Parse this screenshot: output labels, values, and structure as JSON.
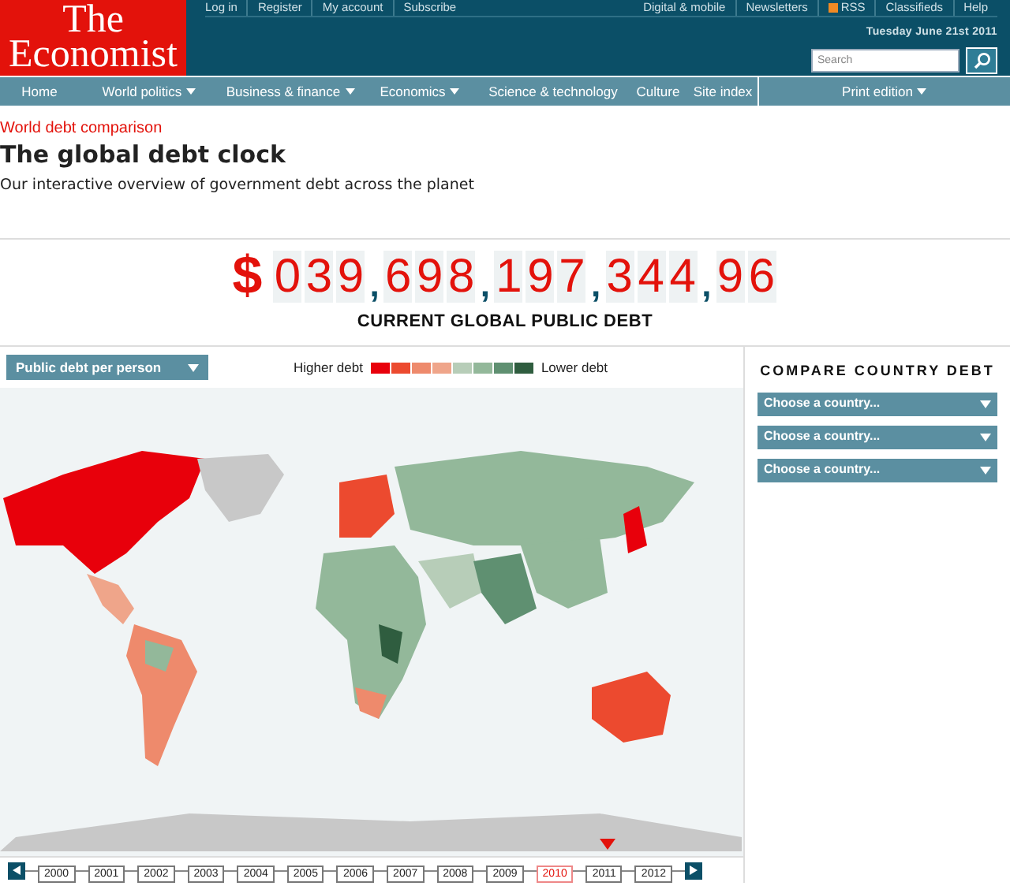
{
  "logo": {
    "line_1": "The",
    "line_2": "Economist"
  },
  "top_links": [
    "Log in",
    "Register",
    "My account",
    "Subscribe"
  ],
  "right_links": [
    {
      "label": "Digital & mobile",
      "kind": "text"
    },
    {
      "label": "Newsletters",
      "kind": "text"
    },
    {
      "label": "RSS",
      "kind": "rss"
    },
    {
      "label": "Classifieds",
      "kind": "text"
    },
    {
      "label": "Help",
      "kind": "text"
    }
  ],
  "date": "Tuesday June 21st 2011",
  "search": {
    "placeholder": "Search"
  },
  "nav": [
    {
      "label": "Home",
      "dropdown": false
    },
    {
      "label": "World politics",
      "dropdown": true
    },
    {
      "label": "Business & finance",
      "dropdown": true
    },
    {
      "label": "Economics",
      "dropdown": true
    },
    {
      "label": "Science & technology",
      "dropdown": false
    },
    {
      "label": "Culture",
      "dropdown": false
    },
    {
      "label": "Site index",
      "dropdown": false
    },
    {
      "label": "Print edition",
      "dropdown": true
    }
  ],
  "kicker": "World debt comparison",
  "title": "The global debt clock",
  "subtitle": "Our interactive overview of government debt across the planet",
  "counter": {
    "currency": "$",
    "separator": ",",
    "groups": [
      [
        "0",
        "3",
        "9"
      ],
      [
        "6",
        "9",
        "8"
      ],
      [
        "1",
        "9",
        "7"
      ],
      [
        "3",
        "4",
        "4"
      ],
      [
        "9",
        "6"
      ]
    ],
    "caption": "CURRENT GLOBAL PUBLIC DEBT"
  },
  "measure_select": "Public debt per person",
  "legend": {
    "high": "Higher debt",
    "low": "Lower debt",
    "swatches": [
      {
        "color": "#e8000b"
      },
      {
        "color": "#ec4a2f"
      },
      {
        "color": "#ee8a6c"
      },
      {
        "color": "#efa58a"
      },
      {
        "color": "#b7cdb8"
      },
      {
        "color": "#93b89a"
      },
      {
        "color": "#5f9071"
      },
      {
        "color": "#2f5d3f"
      }
    ]
  },
  "compare": {
    "title": "COMPARE COUNTRY DEBT",
    "selects": [
      "Choose a country...",
      "Choose a country...",
      "Choose a country..."
    ]
  },
  "years": [
    {
      "label": "2000",
      "selected": false,
      "marker": false
    },
    {
      "label": "2001",
      "selected": false,
      "marker": false
    },
    {
      "label": "2002",
      "selected": false,
      "marker": false
    },
    {
      "label": "2003",
      "selected": false,
      "marker": false
    },
    {
      "label": "2004",
      "selected": false,
      "marker": false
    },
    {
      "label": "2005",
      "selected": false,
      "marker": false
    },
    {
      "label": "2006",
      "selected": false,
      "marker": false
    },
    {
      "label": "2007",
      "selected": false,
      "marker": false
    },
    {
      "label": "2008",
      "selected": false,
      "marker": false
    },
    {
      "label": "2009",
      "selected": false,
      "marker": false
    },
    {
      "label": "2010",
      "selected": true,
      "marker": false
    },
    {
      "label": "2011",
      "selected": false,
      "marker": true
    },
    {
      "label": "2012",
      "selected": false,
      "marker": false
    }
  ]
}
